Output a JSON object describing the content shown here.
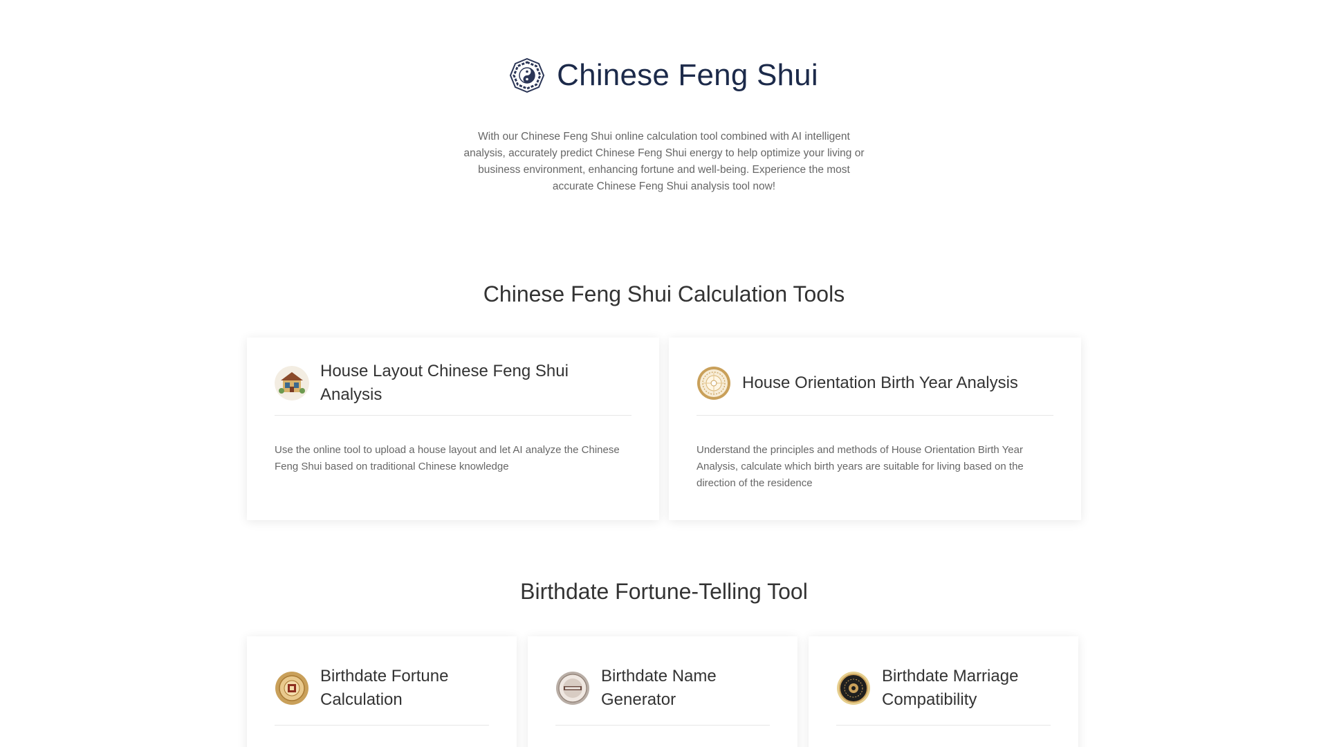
{
  "hero": {
    "title": "Chinese Feng Shui",
    "icon": "bagua-icon",
    "description": "With our Chinese Feng Shui online calculation tool combined with AI intelligent analysis, accurately predict Chinese Feng Shui energy to help optimize your living or business environment, enhancing fortune and well-being. Experience the most accurate Chinese Feng Shui analysis tool now!"
  },
  "calc_tools": {
    "title": "Chinese Feng Shui Calculation Tools",
    "cards": [
      {
        "icon": "house-layout-icon",
        "title": "House Layout Chinese Feng Shui Analysis",
        "description": "Use the online tool to upload a house layout and let AI analyze the Chinese Feng Shui based on traditional Chinese knowledge"
      },
      {
        "icon": "compass-icon",
        "title": "House Orientation Birth Year Analysis",
        "description": "Understand the principles and methods of House Orientation Birth Year Analysis, calculate which birth years are suitable for living based on the direction of the residence"
      }
    ]
  },
  "birthdate_tools": {
    "title": "Birthdate Fortune-Telling Tool",
    "cards": [
      {
        "icon": "fortune-coin-icon",
        "title": "Birthdate Fortune Calculation"
      },
      {
        "icon": "name-seal-icon",
        "title": "Birthdate Name Generator"
      },
      {
        "icon": "marriage-medallion-icon",
        "title": "Birthdate Marriage Compatibility"
      }
    ]
  },
  "colors": {
    "title_navy": "#1c2a4a",
    "text_dark": "#333333",
    "text_gray": "#666666",
    "gold": "#c9a05a"
  }
}
